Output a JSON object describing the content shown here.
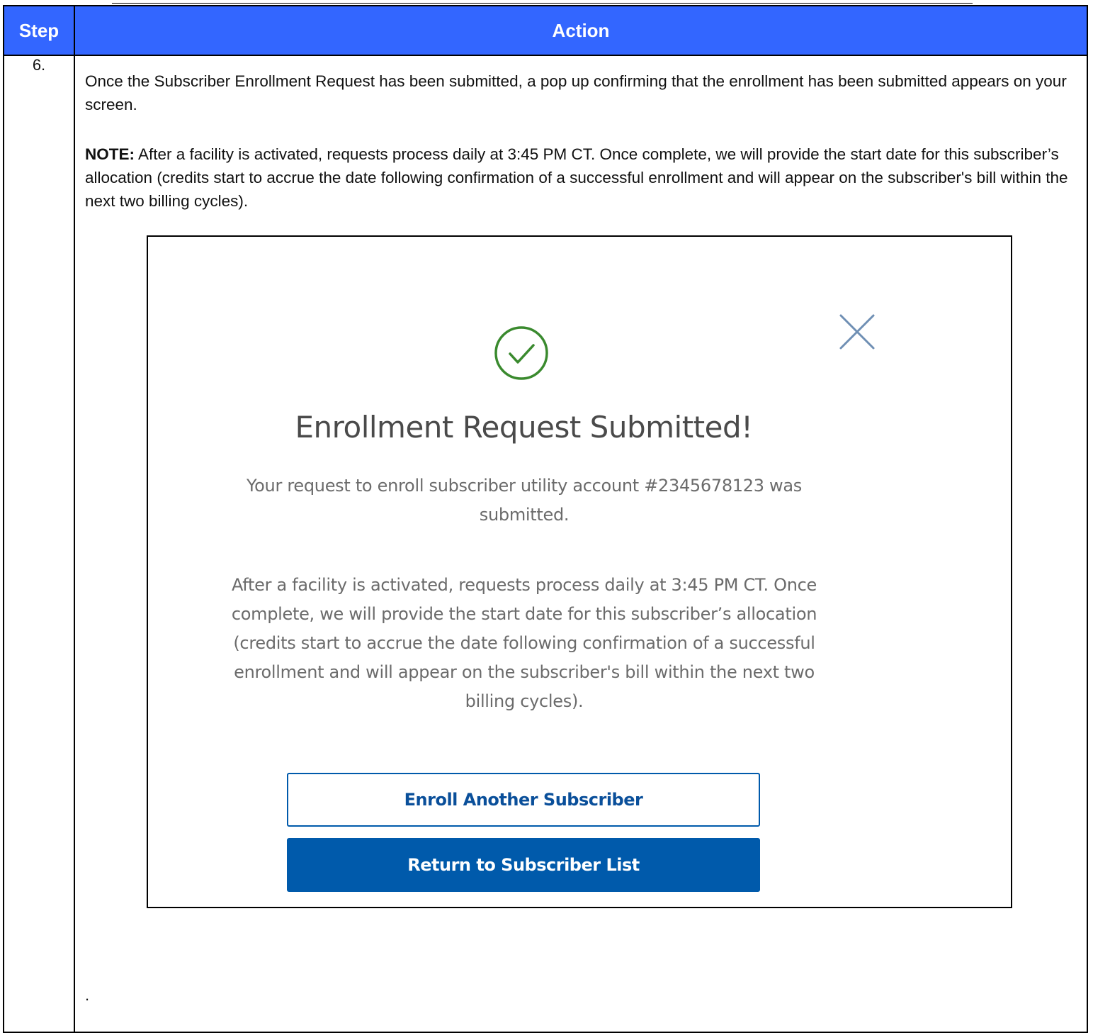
{
  "table": {
    "header_step": "Step",
    "header_action": "Action",
    "step_number": "6.",
    "paragraph1": "Once the Subscriber Enrollment Request has been submitted, a pop up confirming that the enrollment has been submitted appears on your screen.",
    "note_label": "NOTE:",
    "note_text": " After a facility is activated, requests process daily at 3:45 PM CT. Once complete, we will provide the start date for this subscriber’s allocation (credits start to accrue the date following confirmation of a successful enrollment and will appear on the subscriber's bill within the next two billing cycles).",
    "trailing_text": "."
  },
  "modal": {
    "title": "Enrollment Request Submitted!",
    "message1": "Your request to enroll subscriber utility account #2345678123 was submitted.",
    "message2": "After a facility is activated, requests process daily at 3:45 PM CT. Once complete, we will provide the start date for this subscriber’s allocation (credits start to accrue the date following confirmation of a successful enrollment and will appear on the subscriber's bill within the next two billing cycles).",
    "enroll_another_label": "Enroll Another Subscriber",
    "return_label": "Return to Subscriber List",
    "icons": {
      "success": "check-circle-icon",
      "close": "close-icon"
    }
  },
  "colors": {
    "header_bg": "#3366ff",
    "header_text": "#ffffff",
    "primary_button": "#005aab",
    "success_icon": "#3a8a2e",
    "close_icon": "#6f8fb4",
    "modal_text": "#6b6b6b",
    "modal_title": "#4a4a4a"
  }
}
